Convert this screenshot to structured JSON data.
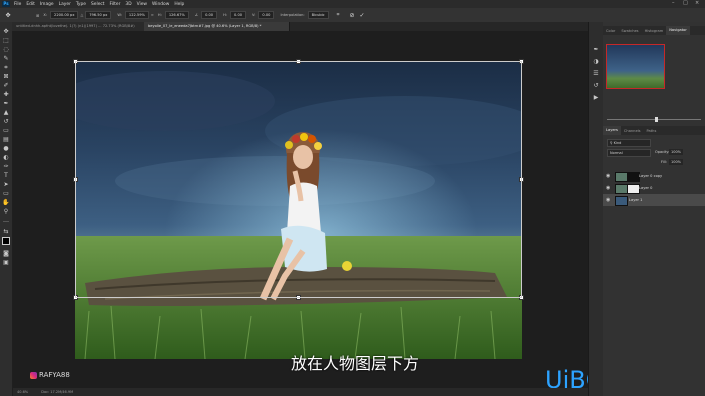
{
  "menu": {
    "app_logo": "Ps",
    "items": [
      "File",
      "Edit",
      "Image",
      "Layer",
      "Type",
      "Select",
      "Filter",
      "3D",
      "View",
      "Window",
      "Help"
    ]
  },
  "options_bar": {
    "x_label": "X:",
    "x_value": "2200.00 px",
    "y_value": "796.50 px",
    "w_label": "W:",
    "w_value": "122.59%",
    "h_label": "H:",
    "h_value": "126.67%",
    "angle_value": "0.00",
    "h_skew": "0.00",
    "v_skew": "0.00",
    "interp_label": "Interpolation:",
    "interp_value": "Bicubic"
  },
  "tabs": [
    {
      "label": "untitled-dnhh-apfnt(lovethe). 1(?) (n1)(1997) ... 72.73% (RGB/8#)"
    },
    {
      "label": "beyolie_07_le_eneeda7Jbtrn#7.jpg @ 40.6% (Layer 1, RGB/8) *"
    }
  ],
  "subtitle": "放在人物图层下方",
  "watermark_left": "RAFYA88",
  "watermark_right": "UiBQ.CoM",
  "status": {
    "zoom": "40.6%",
    "doc": "Doc: 17.2M/46.9M"
  },
  "panel": {
    "top_tabs": [
      "Color",
      "Swatches",
      "Histogram",
      "Navigator"
    ],
    "layer_tabs": [
      "Layers",
      "Channels",
      "Paths"
    ],
    "blend_mode": "Normal",
    "opacity_label": "Opacity:",
    "opacity_value": "100%",
    "fill_label": "Fill:",
    "fill_value": "100%",
    "layers": [
      {
        "name": "Layer 0 copy"
      },
      {
        "name": "Layer 0"
      },
      {
        "name": "Layer 1"
      }
    ]
  },
  "colors": {
    "accent": "#31a8ff",
    "selected_layer": "#4a4a4a",
    "watermark": "#2da3ff"
  }
}
